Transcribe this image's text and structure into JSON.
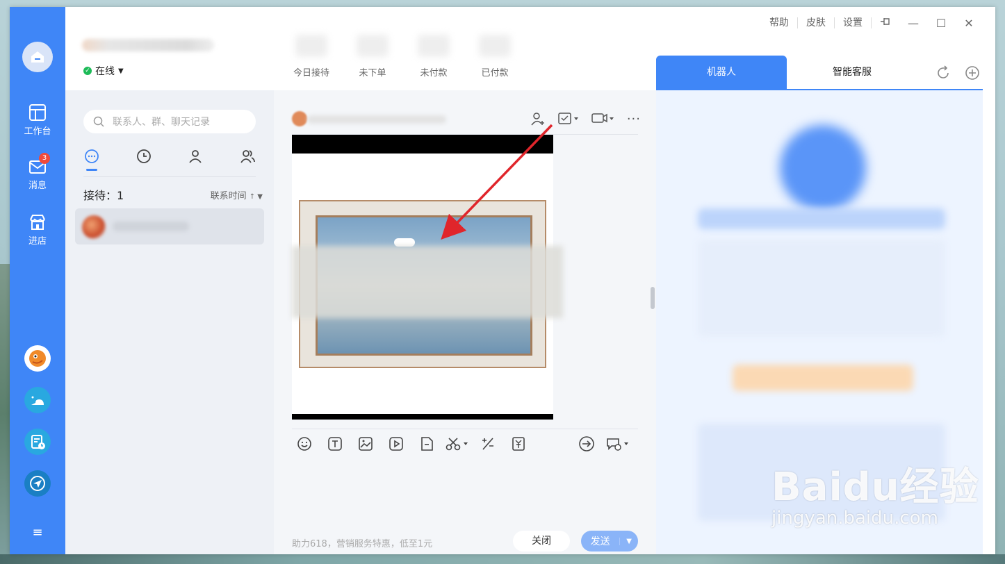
{
  "rail": {
    "items": [
      {
        "label": "工作台",
        "icon": "workbench-icon"
      },
      {
        "label": "消息",
        "icon": "mail-icon",
        "badge": "3"
      },
      {
        "label": "进店",
        "icon": "store-icon"
      }
    ],
    "apps": [
      "fish-mascot-app-icon",
      "snail-app-icon",
      "schedule-app-icon",
      "paper-plane-app-icon"
    ],
    "menu_icon": "hamburger-menu-icon"
  },
  "header": {
    "status": "在线",
    "stats": [
      "今日接待",
      "未下单",
      "未付款",
      "已付款"
    ],
    "menu": [
      "帮助",
      "皮肤",
      "设置"
    ],
    "window_icons": [
      "pin-icon",
      "minimize-icon",
      "maximize-icon",
      "close-icon"
    ]
  },
  "list": {
    "search_placeholder": "联系人、群、聊天记录",
    "tabs": [
      "chat-tab-icon",
      "history-tab-icon",
      "contact-tab-icon",
      "group-tab-icon"
    ],
    "reception_label": "接待：1",
    "sort_label": "联系时间"
  },
  "chat": {
    "promo": "助力618，营销服务特惠，低至1元",
    "close_label": "关闭",
    "send_label": "发送",
    "tools": [
      "emoji-icon",
      "text-icon",
      "image-icon",
      "video-icon",
      "file-icon",
      "scissors-icon",
      "calculator-icon",
      "price-icon",
      "transfer-icon",
      "quick-reply-icon"
    ]
  },
  "right": {
    "tabs": [
      "机器人",
      "智能客服"
    ],
    "tools": [
      "refresh-icon",
      "add-icon"
    ]
  },
  "watermark": {
    "main": "Baidu经验",
    "sub": "jingyan.baidu.com"
  },
  "colors": {
    "brand": "#3f86f7",
    "online": "#1dbb58",
    "badge": "#f04a3a",
    "annotation_arrow": "#e0252b"
  }
}
